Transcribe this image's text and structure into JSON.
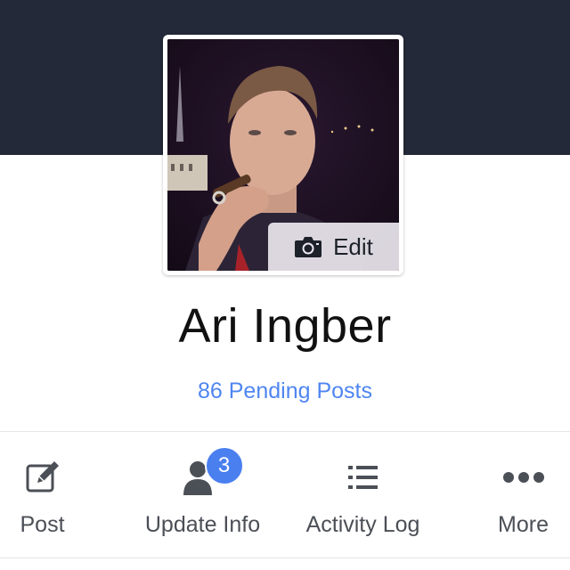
{
  "profile": {
    "name": "Ari Ingber",
    "pending_posts": "86 Pending Posts",
    "edit_label": "Edit"
  },
  "actions": [
    {
      "label": "Post",
      "icon": "compose-icon"
    },
    {
      "label": "Update Info",
      "icon": "person-icon",
      "badge": "3"
    },
    {
      "label": "Activity Log",
      "icon": "list-icon"
    },
    {
      "label": "More",
      "icon": "more-dots-icon"
    }
  ],
  "colors": {
    "cover": "#232938",
    "link": "#4f86f0",
    "badge": "#4a7ff0",
    "icon": "#4b4f56"
  }
}
